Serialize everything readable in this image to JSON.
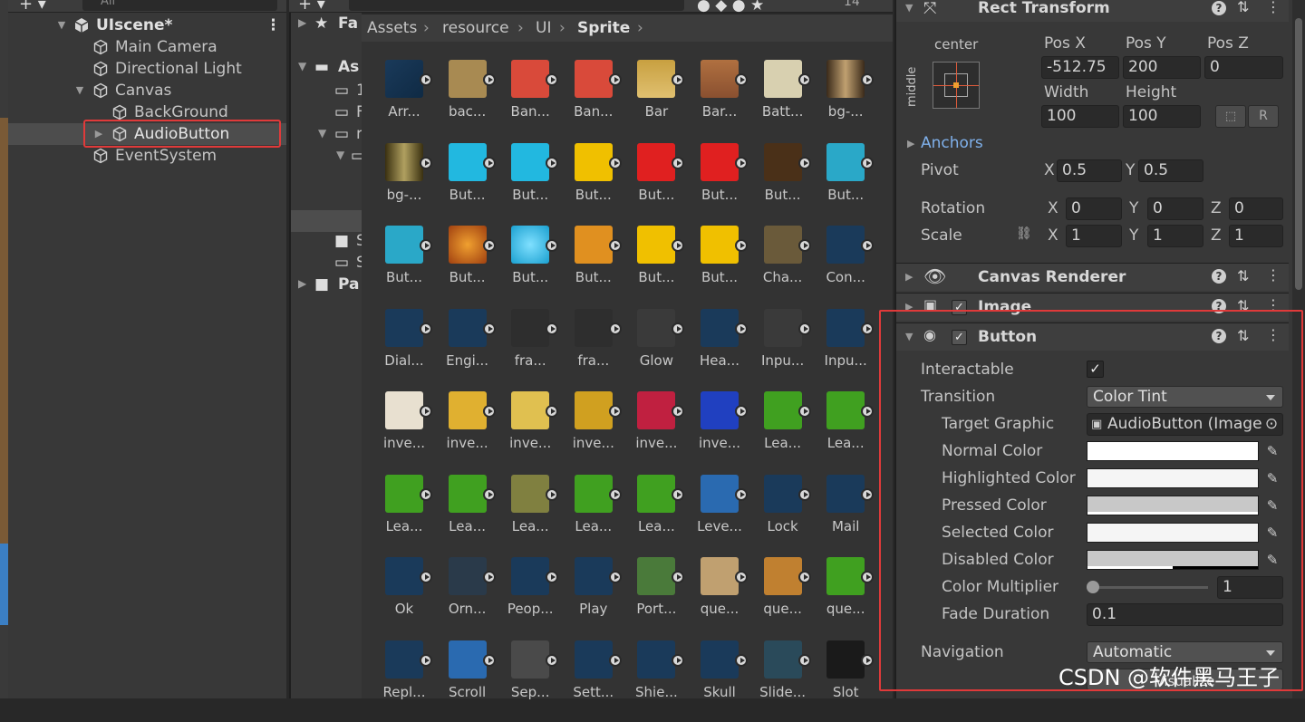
{
  "hierarchy": {
    "search_placeholder": "All",
    "scene": "UIscene*",
    "items": [
      {
        "label": "Main Camera"
      },
      {
        "label": "Directional Light"
      },
      {
        "label": "Canvas"
      },
      {
        "label": "BackGround"
      },
      {
        "label": "AudioButton"
      },
      {
        "label": "EventSystem"
      }
    ]
  },
  "project": {
    "tree": [
      "Fa",
      "As",
      "1",
      "F",
      "r",
      "",
      "S",
      "S",
      "Pa"
    ],
    "top_counter": "14",
    "breadcrumb": [
      "Assets",
      "resource",
      "UI",
      "Sprite"
    ],
    "sprites": [
      "Arr...",
      "bac...",
      "Ban...",
      "Ban...",
      "Bar",
      "Bar...",
      "Batt...",
      "bg-...",
      "bg-...",
      "But...",
      "But...",
      "But...",
      "But...",
      "But...",
      "But...",
      "But...",
      "But...",
      "But...",
      "But...",
      "But...",
      "But...",
      "But...",
      "Cha...",
      "Con...",
      "Dial...",
      "Engi...",
      "fra...",
      "fra...",
      "Glow",
      "Hea...",
      "Inpu...",
      "Inpu...",
      "inve...",
      "inve...",
      "inve...",
      "inve...",
      "inve...",
      "inve...",
      "Lea...",
      "Lea...",
      "Lea...",
      "Lea...",
      "Lea...",
      "Lea...",
      "Lea...",
      "Leve...",
      "Lock",
      "Mail",
      "Ok",
      "Orn...",
      "Peop...",
      "Play",
      "Port...",
      "que...",
      "que...",
      "que...",
      "Repl...",
      "Scroll",
      "Sep...",
      "Sett...",
      "Shie...",
      "Skull",
      "Slide...",
      "Slot"
    ]
  },
  "inspector": {
    "rect_transform": {
      "title": "Rect Transform",
      "anchor_h": "center",
      "anchor_v": "middle",
      "pos_x_label": "Pos X",
      "pos_y_label": "Pos Y",
      "pos_z_label": "Pos Z",
      "pos_x": "-512.75",
      "pos_y": "200",
      "pos_z": "0",
      "width_label": "Width",
      "height_label": "Height",
      "width": "100",
      "height": "100",
      "anchors": "Anchors",
      "pivot": "Pivot",
      "pivot_x": "0.5",
      "pivot_y": "0.5",
      "rotation": "Rotation",
      "rot_x": "0",
      "rot_y": "0",
      "rot_z": "0",
      "scale": "Scale",
      "scale_x": "1",
      "scale_y": "1",
      "scale_z": "1",
      "x": "X",
      "y": "Y",
      "z": "Z"
    },
    "canvas_renderer": "Canvas Renderer",
    "image": "Image",
    "button": {
      "title": "Button",
      "interactable": "Interactable",
      "transition": "Transition",
      "transition_value": "Color Tint",
      "target_graphic": "Target Graphic",
      "target_graphic_value": "AudioButton (Image",
      "normal_color": "Normal Color",
      "highlighted_color": "Highlighted Color",
      "pressed_color": "Pressed Color",
      "selected_color": "Selected Color",
      "disabled_color": "Disabled Color",
      "color_multiplier": "Color Multiplier",
      "color_multiplier_value": "1",
      "fade_duration": "Fade Duration",
      "fade_duration_value": "0.1",
      "navigation": "Navigation",
      "navigation_value": "Automatic",
      "visualize": "Visualize"
    },
    "colors": {
      "normal": "#ffffff",
      "highlighted": "#f5f5f5",
      "pressed": "#c8c8c8",
      "selected": "#f5f5f5",
      "disabled": "#c8c8c8"
    }
  },
  "watermark": "CSDN @软件黑马王子"
}
